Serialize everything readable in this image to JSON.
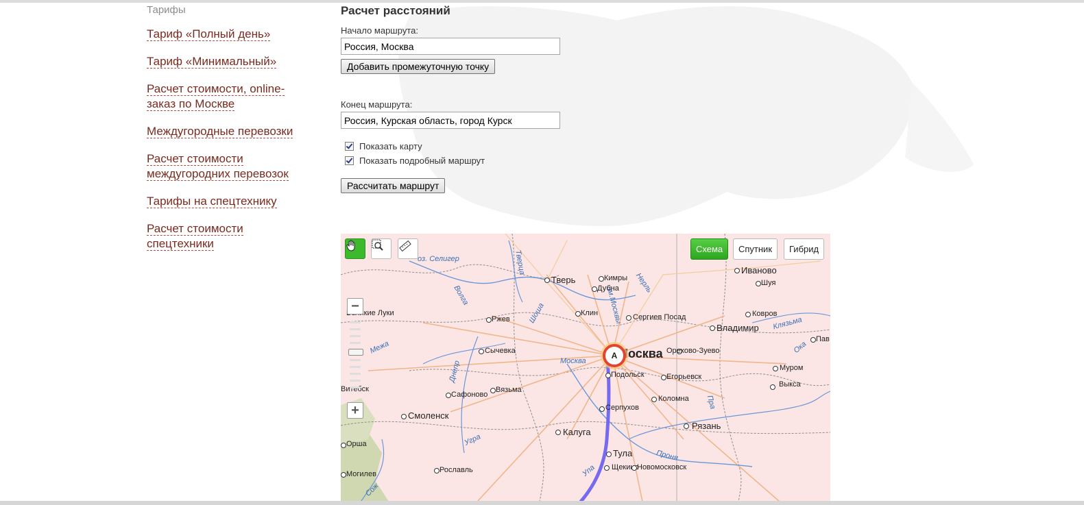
{
  "sidebar": {
    "heading": "Тарифы",
    "items": [
      {
        "label": "Тариф «Полный день»"
      },
      {
        "label": "Тариф «Минимальный»"
      },
      {
        "label": "Расчет стоимости, online-заказ по Москве"
      },
      {
        "label": "Междугородные перевозки"
      },
      {
        "label": "Расчет стоимости междугородних перевозок"
      },
      {
        "label": "Тарифы на спецтехнику"
      },
      {
        "label": "Расчет стоимости спецтехники"
      }
    ]
  },
  "form": {
    "title": "Расчет расстояний",
    "start_label": "Начало маршрута:",
    "start_value": "Россия, Москва",
    "add_point_button": "Добавить промежуточную точку",
    "end_label": "Конец маршрута:",
    "end_value": "Россия, Курская область, город Курск",
    "show_map_label": "Показать карту",
    "show_map_checked": true,
    "show_route_label": "Показать подробный маршрут",
    "show_route_checked": true,
    "calculate_button": "Рассчитать маршрут"
  },
  "map": {
    "types": {
      "scheme": "Схема",
      "satellite": "Спутник",
      "hybrid": "Гибрид"
    },
    "active_type": "Схема",
    "marker_label": "A",
    "route_color": "#6a5df0",
    "labels": {
      "seliger": "оз. Селигер",
      "tver_city": "Тверь",
      "kimry": "Кимры",
      "dubna": "Дубна",
      "ivanovo": "Иваново",
      "shuya": "Шуя",
      "velikie_luki": "Великие Луки",
      "rzhev": "Ржев",
      "klin": "Клин",
      "sergiev_posad": "Сергиев Посад",
      "kovrov": "Ковров",
      "vladimir": "Владимир",
      "pav": "Пав",
      "sychevka": "Сычевка",
      "moskva_river": "Москва",
      "moskva": "Москва",
      "orekhovo": "Орехово-Зуево",
      "murom": "Муром",
      "podolsk": "Подольск",
      "egoryevsk": "Егорьевск",
      "vyksa": "Выкса",
      "vitebsk": "Витебск",
      "vyazma": "Вязьма",
      "safonovo": "Сафоново",
      "kolomna": "Коломна",
      "serpukhov": "Серпухов",
      "smolensk": "Смоленск",
      "kaluga": "Калуга",
      "ryazan": "Рязань",
      "orsha": "Орша",
      "tula": "Тула",
      "pronya": "Проня",
      "shchekino": "Щекино",
      "novomoskovsk": "Новомосковск",
      "roslavl": "Рославль",
      "mogilev": "Могилев",
      "volga": "Волга",
      "tvertsa": "Тверца",
      "nerl": "Нерль",
      "shosha": "Шоша",
      "ugra": "Угра",
      "mezha": "Межа",
      "dnepr": "Днепр",
      "oka": "Ока",
      "pra": "Пра",
      "klyazma": "Клязьма",
      "sozh": "Сож",
      "upa": "Упа",
      "im_moskvy": "им.Москвы"
    }
  }
}
